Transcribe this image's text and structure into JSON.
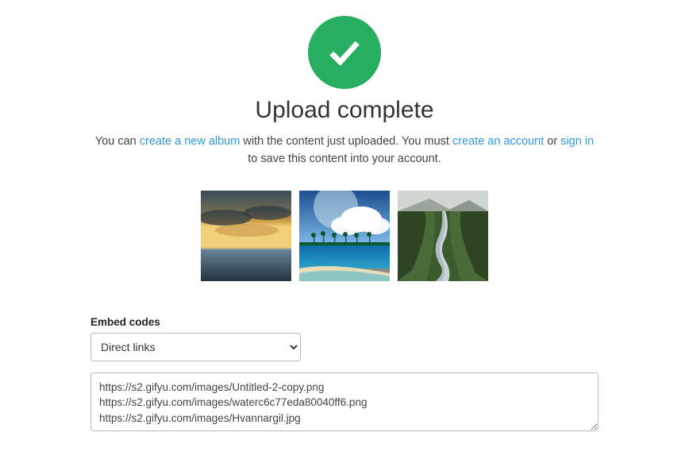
{
  "heading": "Upload complete",
  "subtitle": {
    "prefix": "You can ",
    "link_create_album": "create a new album",
    "middle1": " with the content just uploaded. You must ",
    "link_create_account": "create an account",
    "middle2": " or ",
    "link_sign_in": "sign in",
    "suffix": " to save this content into your account."
  },
  "thumbnails": [
    {
      "name": "thumbnail-sunset-sea"
    },
    {
      "name": "thumbnail-beach-palms"
    },
    {
      "name": "thumbnail-canyon-river"
    }
  ],
  "embed": {
    "label": "Embed codes",
    "selected_option": "Direct links",
    "textarea_value": "https://s2.gifyu.com/images/Untitled-2-copy.png\nhttps://s2.gifyu.com/images/waterc6c77eda80040ff6.png\nhttps://s2.gifyu.com/images/Hvannargil.jpg"
  }
}
